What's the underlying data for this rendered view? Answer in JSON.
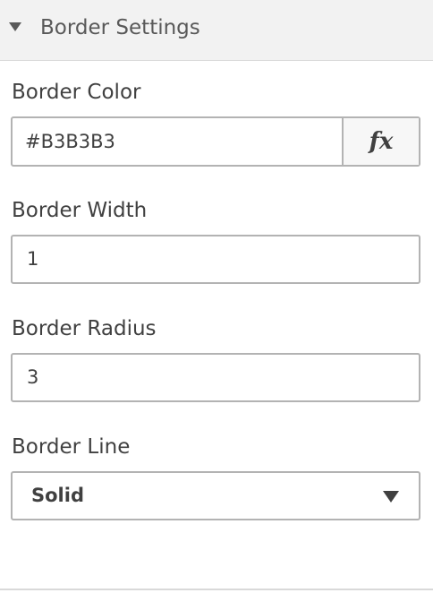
{
  "section": {
    "title": "Border Settings",
    "expanded": true,
    "caret_icon": "caret-down-icon"
  },
  "border_color": {
    "label": "Border Color",
    "value": "#B3B3B3",
    "fx_label": "fx"
  },
  "border_width": {
    "label": "Border Width",
    "value": "1"
  },
  "border_radius": {
    "label": "Border Radius",
    "value": "3"
  },
  "border_line": {
    "label": "Border Line",
    "selected": "Solid",
    "dropdown_icon": "caret-down-icon"
  },
  "colors": {
    "header_bg": "#f2f2f2",
    "input_border": "#b3b3b3",
    "text": "#404040"
  }
}
